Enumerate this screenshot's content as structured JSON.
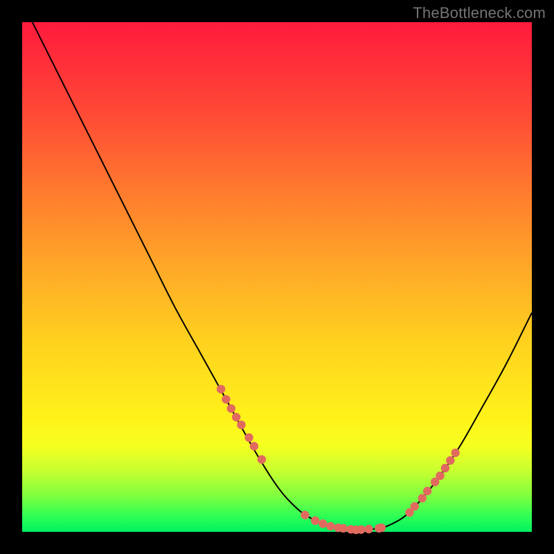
{
  "watermark": "TheBottleneck.com",
  "colors": {
    "page_bg": "#000000",
    "gradient_top": "#ff1a3c",
    "gradient_mid": "#ffd21e",
    "gradient_bottom": "#00f060",
    "curve_stroke": "#000000",
    "marker_fill": "#e16a5f"
  },
  "chart_data": {
    "type": "line",
    "title": "",
    "xlabel": "",
    "ylabel": "",
    "xlim": [
      0,
      100
    ],
    "ylim": [
      0,
      100
    ],
    "grid": false,
    "legend": false,
    "series": [
      {
        "name": "curve",
        "x": [
          0,
          5,
          10,
          15,
          20,
          25,
          30,
          35,
          40,
          45,
          48,
          50,
          52,
          55,
          58,
          60,
          63,
          66,
          70,
          72,
          75,
          78,
          82,
          86,
          90,
          95,
          100
        ],
        "values": [
          104,
          94,
          84,
          74,
          64,
          54,
          44,
          35,
          26,
          17,
          12,
          9,
          6.5,
          3.7,
          2.0,
          1.2,
          0.7,
          0.4,
          0.7,
          1.3,
          3.0,
          6.0,
          11,
          17,
          24,
          33,
          43
        ]
      }
    ],
    "markers": {
      "name": "highlighted-points",
      "x": [
        39.0,
        40.0,
        41.0,
        42.0,
        43.0,
        44.5,
        45.5,
        47.0,
        55.5,
        57.5,
        59.0,
        60.5,
        62.0,
        63.0,
        64.5,
        65.5,
        66.5,
        68.0,
        70.0,
        70.5,
        76.0,
        77.0,
        78.5,
        79.5,
        81.0,
        82.0,
        83.0,
        84.0,
        85.0
      ],
      "values": [
        28.0,
        26.0,
        24.2,
        22.5,
        21.0,
        18.5,
        16.8,
        14.2,
        3.3,
        2.2,
        1.6,
        1.1,
        0.8,
        0.7,
        0.5,
        0.4,
        0.45,
        0.55,
        0.7,
        0.8,
        3.8,
        5.0,
        6.6,
        8.0,
        9.8,
        11.0,
        12.5,
        14.0,
        15.5
      ]
    }
  }
}
